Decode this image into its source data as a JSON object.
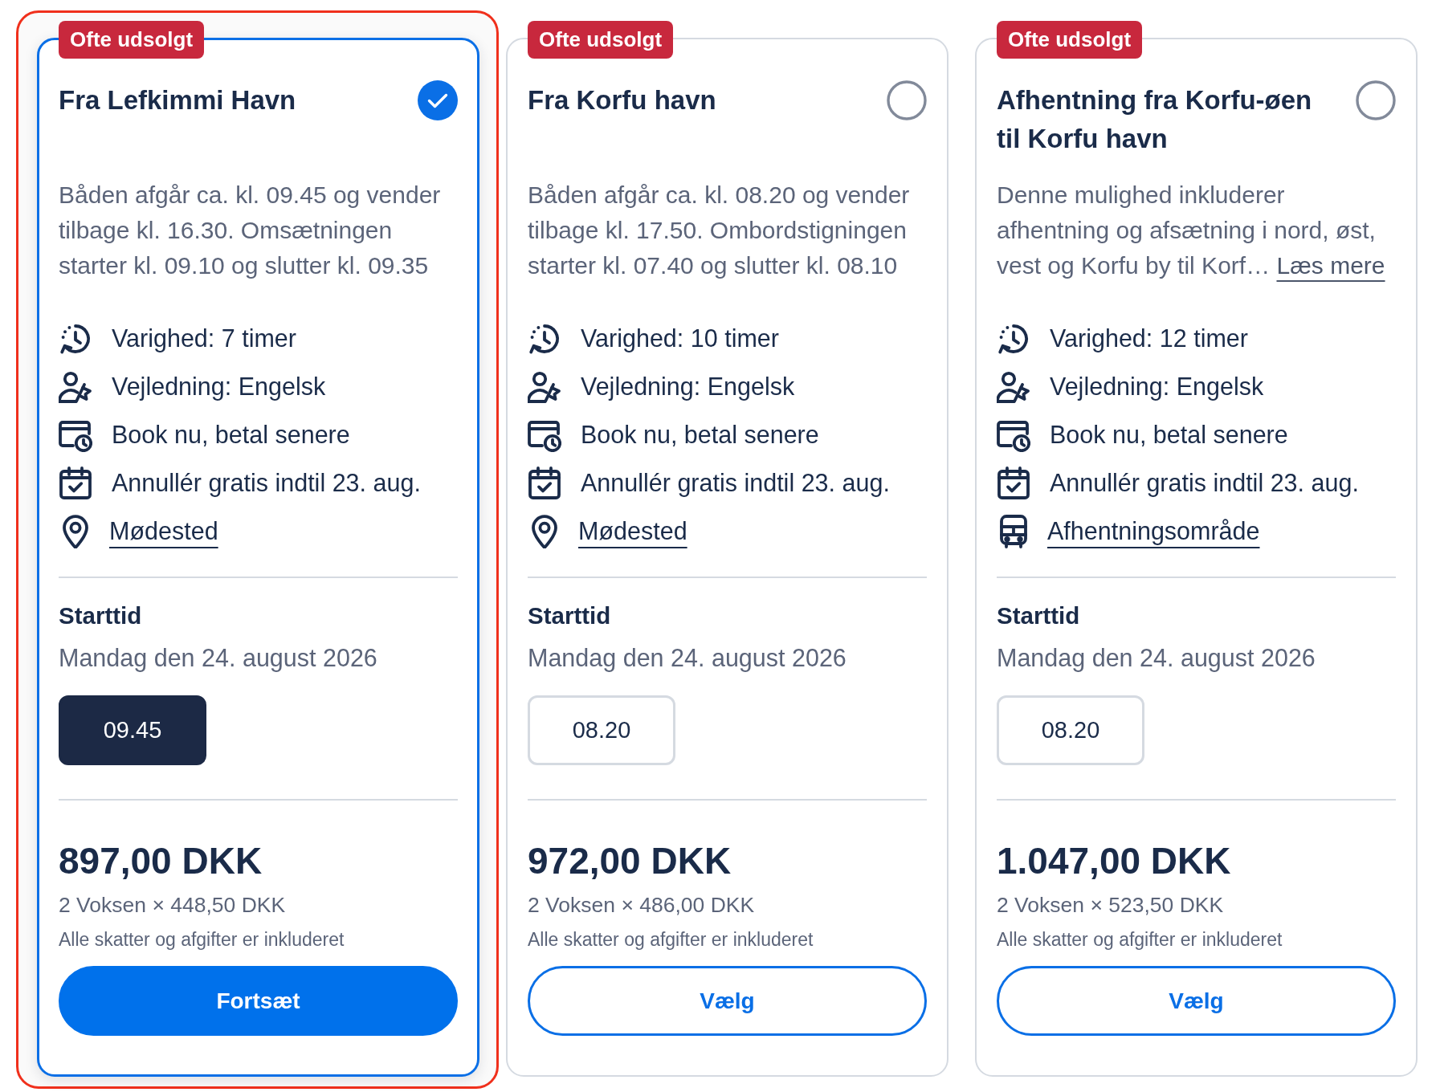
{
  "options": [
    {
      "highlighted": true,
      "selected": true,
      "badge": "Ofte udsolgt",
      "title": "Fra Lefkimmi Havn",
      "description": "Båden afgår ca. kl. 09.45 og vender tilbage kl. 16.30. Omsætningen starter kl. 09.10 og slutter kl. 09.35",
      "features": [
        {
          "kind": "duration",
          "label": "Varighed: 7 timer"
        },
        {
          "kind": "guide",
          "label": "Vejledning: Engelsk"
        },
        {
          "kind": "pay_later",
          "label": "Book nu, betal senere"
        },
        {
          "kind": "cancel",
          "label": "Annullér gratis indtil 23. aug."
        }
      ],
      "location_link": {
        "kind": "meeting_point",
        "label": "Mødested"
      },
      "start_heading": "Starttid",
      "start_date": "Mandag den 24. august 2026",
      "times": [
        {
          "label": "09.45",
          "selected": true
        }
      ],
      "price": "897,00 DKK",
      "price_breakdown": "2 Voksen × 448,50 DKK",
      "tax_note": "Alle skatter og afgifter er inkluderet",
      "action": {
        "kind": "primary",
        "label": "Fortsæt"
      }
    },
    {
      "highlighted": false,
      "selected": false,
      "badge": "Ofte udsolgt",
      "title": "Fra Korfu havn",
      "description": "Båden afgår ca. kl. 08.20 og vender tilbage kl. 17.50. Ombordstigningen starter kl. 07.40 og slutter kl. 08.10",
      "features": [
        {
          "kind": "duration",
          "label": "Varighed: 10 timer"
        },
        {
          "kind": "guide",
          "label": "Vejledning: Engelsk"
        },
        {
          "kind": "pay_later",
          "label": "Book nu, betal senere"
        },
        {
          "kind": "cancel",
          "label": "Annullér gratis indtil 23. aug."
        }
      ],
      "location_link": {
        "kind": "meeting_point",
        "label": "Mødested"
      },
      "start_heading": "Starttid",
      "start_date": "Mandag den 24. august 2026",
      "times": [
        {
          "label": "08.20",
          "selected": false
        }
      ],
      "price": "972,00 DKK",
      "price_breakdown": "2 Voksen × 486,00 DKK",
      "tax_note": "Alle skatter og afgifter er inkluderet",
      "action": {
        "kind": "outline",
        "label": "Vælg"
      }
    },
    {
      "highlighted": false,
      "selected": false,
      "badge": "Ofte udsolgt",
      "title": "Afhentning fra Korfu-øen til Korfu havn",
      "description": "Denne mulighed inkluderer afhentning og afsætning i nord, øst, vest og Korfu by til Korf…",
      "read_more": "Læs mere",
      "features": [
        {
          "kind": "duration",
          "label": "Varighed: 12 timer"
        },
        {
          "kind": "guide",
          "label": "Vejledning: Engelsk"
        },
        {
          "kind": "pay_later",
          "label": "Book nu, betal senere"
        },
        {
          "kind": "cancel",
          "label": "Annullér gratis indtil 23. aug."
        }
      ],
      "location_link": {
        "kind": "pickup",
        "label": "Afhentningsområde"
      },
      "start_heading": "Starttid",
      "start_date": "Mandag den 24. august 2026",
      "times": [
        {
          "label": "08.20",
          "selected": false
        }
      ],
      "price": "1.047,00 DKK",
      "price_breakdown": "2 Voksen × 523,50 DKK",
      "tax_note": "Alle skatter og afgifter er inkluderet",
      "action": {
        "kind": "outline",
        "label": "Vælg"
      }
    }
  ]
}
